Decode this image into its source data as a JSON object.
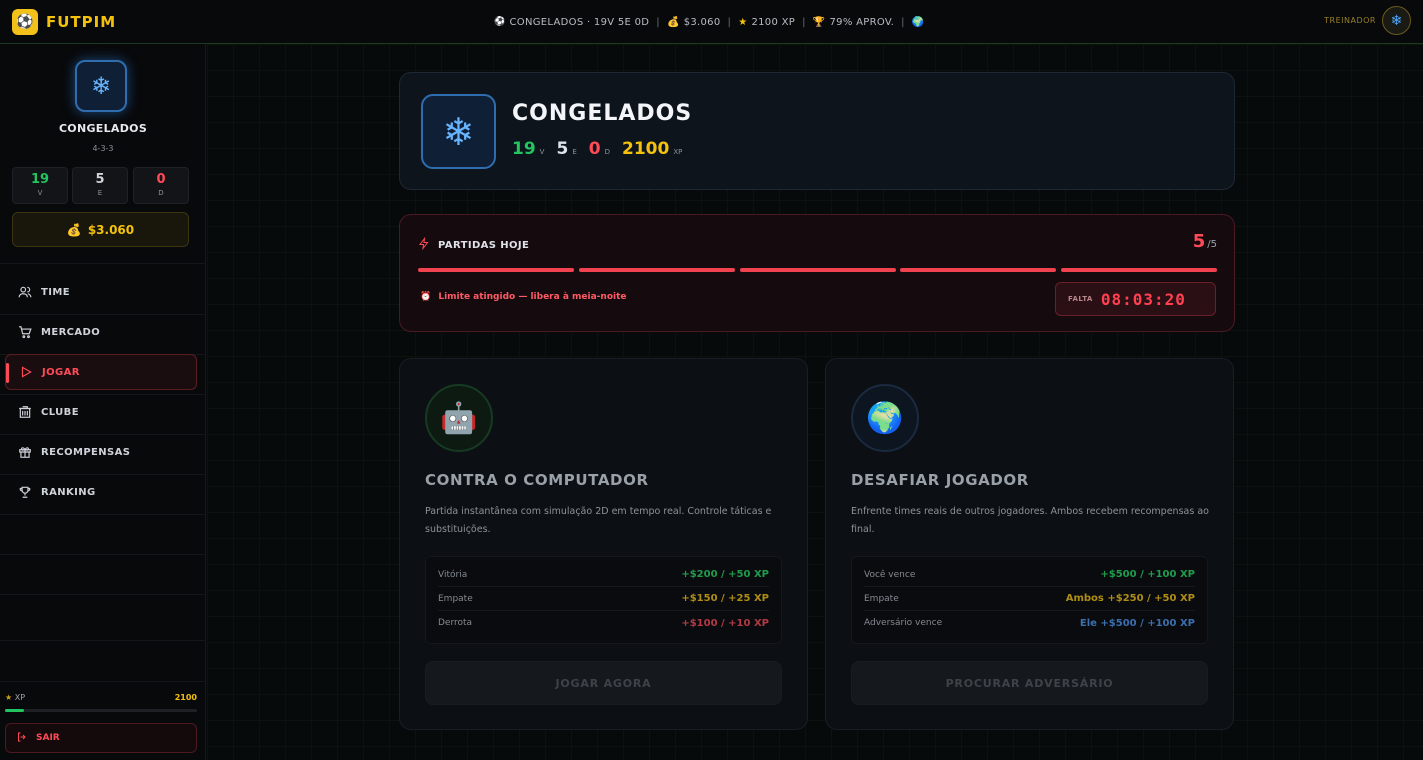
{
  "app": {
    "name": "FUTPIM"
  },
  "ticker": [
    {
      "icon": "⚽",
      "text": "CONGELADOS · 19V 5E 0D"
    },
    {
      "icon": "💰",
      "text": "$3.060"
    },
    {
      "icon": "⭐",
      "text": "2100 XP"
    },
    {
      "icon": "🏆",
      "text": "79% APROV."
    },
    {
      "icon": "🌍",
      "text": ""
    }
  ],
  "header": {
    "trainer_label": "TREINADOR"
  },
  "sidebar": {
    "team_name": "CONGELADOS",
    "formation": "4-3-3",
    "stats": [
      {
        "value": "19",
        "label": "V"
      },
      {
        "value": "5",
        "label": "E"
      },
      {
        "value": "0",
        "label": "D"
      }
    ],
    "money": "$3.060",
    "nav": [
      {
        "label": "TIME"
      },
      {
        "label": "MERCADO"
      },
      {
        "label": "JOGAR"
      },
      {
        "label": "CLUBE"
      },
      {
        "label": "RECOMPENSAS"
      },
      {
        "label": "RANKING"
      }
    ],
    "xp_label": "XP",
    "xp_value": "2100",
    "xp_progress": 0.1,
    "logout_label": "SAIR"
  },
  "team_card": {
    "name": "CONGELADOS",
    "wins": "19",
    "wins_label": "V",
    "draws": "5",
    "draws_label": "E",
    "losses": "0",
    "losses_label": "D",
    "xp": "2100",
    "xp_label": "XP"
  },
  "matches_today": {
    "title": "PARTIDAS HOJE",
    "current": "5",
    "total": "/5",
    "note": "Limite atingido — libera à meia-noite",
    "timer_label": "FALTA",
    "timer_value": "08:03:20"
  },
  "modes": [
    {
      "title": "CONTRA O COMPUTADOR",
      "description": "Partida instantânea com simulação 2D em tempo real. Controle táticas e substituições.",
      "rewards": [
        {
          "label": "Vitória",
          "value": "+$200 / +50 XP"
        },
        {
          "label": "Empate",
          "value": "+$150 / +25 XP"
        },
        {
          "label": "Derrota",
          "value": "+$100 / +10 XP"
        }
      ],
      "button": "JOGAR AGORA"
    },
    {
      "title": "DESAFIAR JOGADOR",
      "description": "Enfrente times reais de outros jogadores. Ambos recebem recompensas ao final.",
      "rewards": [
        {
          "label": "Você vence",
          "value": "+$500 / +100 XP"
        },
        {
          "label": "Empate",
          "value": "Ambos +$250 / +50 XP"
        },
        {
          "label": "Adversário vence",
          "value": "Ele +$500 / +100 XP"
        }
      ],
      "button": "PROCURAR ADVERSÁRIO"
    }
  ],
  "colors": {
    "accent_gold": "#f4c20d",
    "win_green": "#22c55e",
    "loss_red": "#ff4b57",
    "ice_blue": "#67b4ff",
    "draw_gold": "#c9a21b",
    "adversary_blue": "#3b82d6"
  }
}
